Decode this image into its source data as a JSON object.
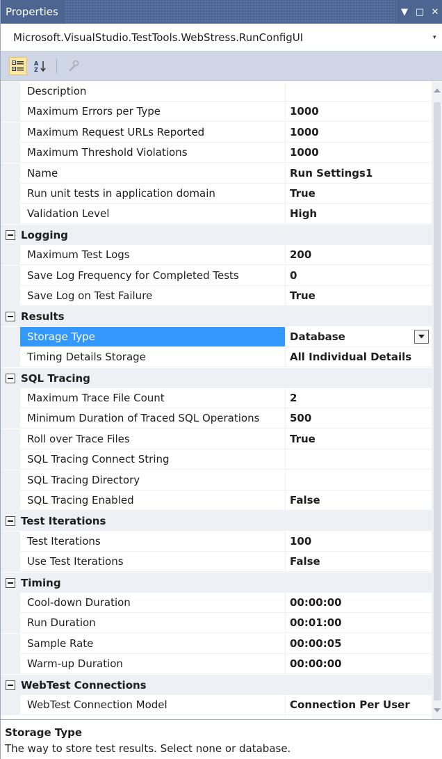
{
  "window": {
    "title": "Properties",
    "buttons": {
      "dropdown": "▼",
      "maximize": "□",
      "close": "✕"
    }
  },
  "object_selector": {
    "value": "Microsoft.VisualStudio.TestTools.WebStress.RunConfigUI"
  },
  "toolbar": {
    "items": [
      {
        "name": "categorized-icon",
        "active": true
      },
      {
        "name": "alphabetical-icon",
        "active": false
      },
      {
        "name": "property-pages-icon",
        "active": false,
        "disabled": true
      }
    ]
  },
  "grid": {
    "rows": [
      {
        "type": "prop",
        "name": "Description",
        "value": ""
      },
      {
        "type": "prop",
        "name": "Maximum Errors per Type",
        "value": "1000"
      },
      {
        "type": "prop",
        "name": "Maximum Request URLs Reported",
        "value": "1000"
      },
      {
        "type": "prop",
        "name": "Maximum Threshold Violations",
        "value": "1000"
      },
      {
        "type": "prop",
        "name": "Name",
        "value": "Run Settings1"
      },
      {
        "type": "prop",
        "name": "Run unit tests in application domain",
        "value": "True"
      },
      {
        "type": "prop",
        "name": "Validation Level",
        "value": "High"
      },
      {
        "type": "category",
        "name": "Logging"
      },
      {
        "type": "prop",
        "name": "Maximum Test Logs",
        "value": "200"
      },
      {
        "type": "prop",
        "name": "Save Log Frequency for Completed Tests",
        "value": "0"
      },
      {
        "type": "prop",
        "name": "Save Log on Test Failure",
        "value": "True"
      },
      {
        "type": "category",
        "name": "Results"
      },
      {
        "type": "prop",
        "name": "Storage Type",
        "value": "Database",
        "selected": true,
        "dropdown": true
      },
      {
        "type": "prop",
        "name": "Timing Details Storage",
        "value": "All Individual Details"
      },
      {
        "type": "category",
        "name": "SQL Tracing"
      },
      {
        "type": "prop",
        "name": "Maximum Trace File Count",
        "value": "2"
      },
      {
        "type": "prop",
        "name": "Minimum Duration of Traced SQL Operations",
        "value": "500"
      },
      {
        "type": "prop",
        "name": "Roll over Trace Files",
        "value": "True"
      },
      {
        "type": "prop",
        "name": "SQL Tracing Connect String",
        "value": ""
      },
      {
        "type": "prop",
        "name": "SQL Tracing Directory",
        "value": ""
      },
      {
        "type": "prop",
        "name": "SQL Tracing Enabled",
        "value": "False"
      },
      {
        "type": "category",
        "name": "Test Iterations"
      },
      {
        "type": "prop",
        "name": "Test Iterations",
        "value": "100"
      },
      {
        "type": "prop",
        "name": "Use Test Iterations",
        "value": "False"
      },
      {
        "type": "category",
        "name": "Timing"
      },
      {
        "type": "prop",
        "name": "Cool-down Duration",
        "value": "00:00:00"
      },
      {
        "type": "prop",
        "name": "Run Duration",
        "value": "00:01:00"
      },
      {
        "type": "prop",
        "name": "Sample Rate",
        "value": "00:00:05"
      },
      {
        "type": "prop",
        "name": "Warm-up Duration",
        "value": "00:00:00"
      },
      {
        "type": "category",
        "name": "WebTest Connections"
      },
      {
        "type": "prop",
        "name": "WebTest Connection Model",
        "value": "Connection Per User"
      }
    ]
  },
  "description": {
    "title": "Storage Type",
    "text": "The way to store test results. Select none or database."
  },
  "colors": {
    "titlebar": "#4c6591",
    "selection": "#3399ff",
    "toolbar": "#cfd6e5",
    "gutter": "#edf0f5"
  }
}
